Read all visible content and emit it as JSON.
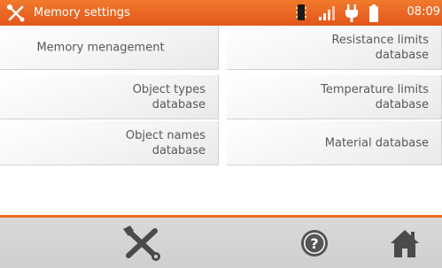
{
  "header": {
    "title": "Memory settings",
    "time": "08:09",
    "icon": "wrench-screwdriver-icon",
    "status_icons": [
      "memory-card-icon",
      "signal-icon",
      "plug-icon",
      "battery-icon"
    ]
  },
  "menu": {
    "items": [
      {
        "label": "Memory menagement"
      },
      {
        "label": "Resistance limits\ndatabase"
      },
      {
        "label": "Object types\ndatabase"
      },
      {
        "label": "Temperature limits\ndatabase"
      },
      {
        "label": "Object names\ndatabase"
      },
      {
        "label": "Material database"
      }
    ]
  },
  "footer": {
    "buttons": [
      "settings-icon",
      "help-icon",
      "home-icon"
    ]
  },
  "colors": {
    "accent": "#e8601f",
    "tile_text": "#585858",
    "footer_bg": "#d4d4d4"
  }
}
